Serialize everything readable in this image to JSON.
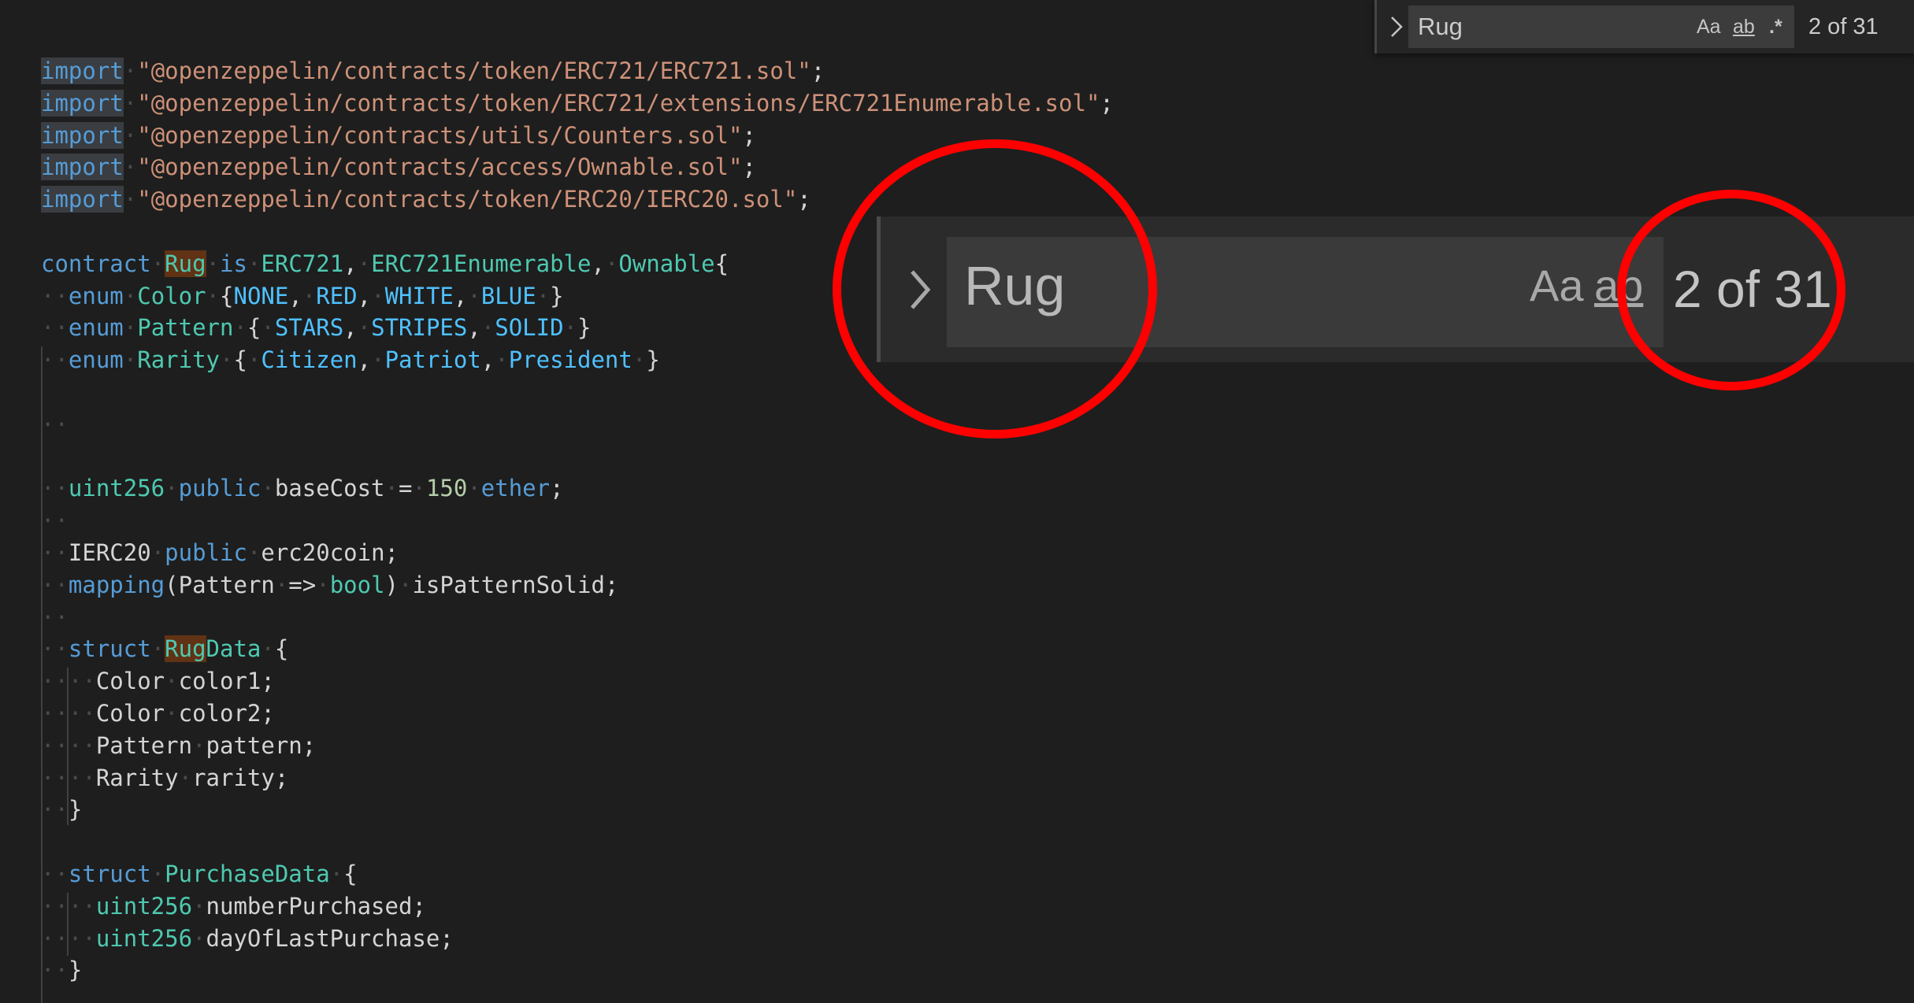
{
  "find_widget": {
    "query": "Rug",
    "match_case_label": "Aa",
    "whole_word_label": "ab",
    "regex_label": ".*",
    "match_count": "2 of 31"
  },
  "code": {
    "import_kw": "import",
    "imports": [
      "\"@openzeppelin/contracts/token/ERC721/ERC721.sol\"",
      "\"@openzeppelin/contracts/token/ERC721/extensions/ERC721Enumerable.sol\"",
      "\"@openzeppelin/contracts/utils/Counters.sol\"",
      "\"@openzeppelin/contracts/access/Ownable.sol\"",
      "\"@openzeppelin/contracts/token/ERC20/IERC20.sol\""
    ],
    "contract_kw": "contract",
    "contract_name": "Rug",
    "is_kw": "is",
    "parents": [
      "ERC721",
      "ERC721Enumerable",
      "Ownable"
    ],
    "enum_kw": "enum",
    "enums": [
      {
        "name": "Color",
        "values": [
          "NONE",
          "RED",
          "WHITE",
          "BLUE"
        ]
      },
      {
        "name": "Pattern",
        "values": [
          "STARS",
          "STRIPES",
          "SOLID"
        ]
      },
      {
        "name": "Rarity",
        "values": [
          "Citizen",
          "Patriot",
          "President"
        ]
      }
    ],
    "uint_type": "uint256",
    "public_kw": "public",
    "base_cost_name": "baseCost",
    "base_cost_value": "150",
    "ether_kw": "ether",
    "ierc20_type": "IERC20",
    "erc20_name": "erc20coin",
    "mapping_kw": "mapping",
    "bool_type": "bool",
    "mapping_key": "Pattern",
    "mapping_name": "isPatternSolid",
    "struct_kw": "struct",
    "rugdata_name": "RugData",
    "rugdata_fields": [
      {
        "type": "Color",
        "name": "color1"
      },
      {
        "type": "Color",
        "name": "color2"
      },
      {
        "type": "Pattern",
        "name": "pattern"
      },
      {
        "type": "Rarity",
        "name": "rarity"
      }
    ],
    "purchase_name": "PurchaseData",
    "purchase_fields": [
      {
        "type": "uint256",
        "name": "numberPurchased"
      },
      {
        "type": "uint256",
        "name": "dayOfLastPurchase"
      }
    ]
  },
  "colors": {
    "annotation": "#ff0000",
    "keyword": "#569cd6",
    "type": "#4ec9b0",
    "string": "#ce9178",
    "match_highlight": "#613214"
  }
}
